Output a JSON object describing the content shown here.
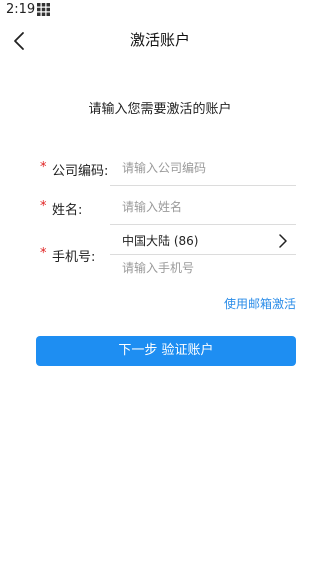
{
  "status_bar": {
    "time": "2:19"
  },
  "header": {
    "title": "激活账户",
    "back_icon": "chevron-left-icon"
  },
  "prompt": "请输入您需要激活的账户",
  "form": {
    "required_mark": "*",
    "company_code": {
      "label": "公司编码:",
      "placeholder": "请输入公司编码"
    },
    "name": {
      "label": "姓名:",
      "placeholder": "请输入姓名"
    },
    "phone": {
      "label": "手机号:",
      "country": "中国大陆 (86)",
      "placeholder": "请输入手机号"
    }
  },
  "email_activate_link": "使用邮箱激活",
  "next_button": "下一步 验证账户",
  "colors": {
    "accent": "#1e8ef2",
    "link": "#2a8ce8",
    "required": "#e02020"
  }
}
